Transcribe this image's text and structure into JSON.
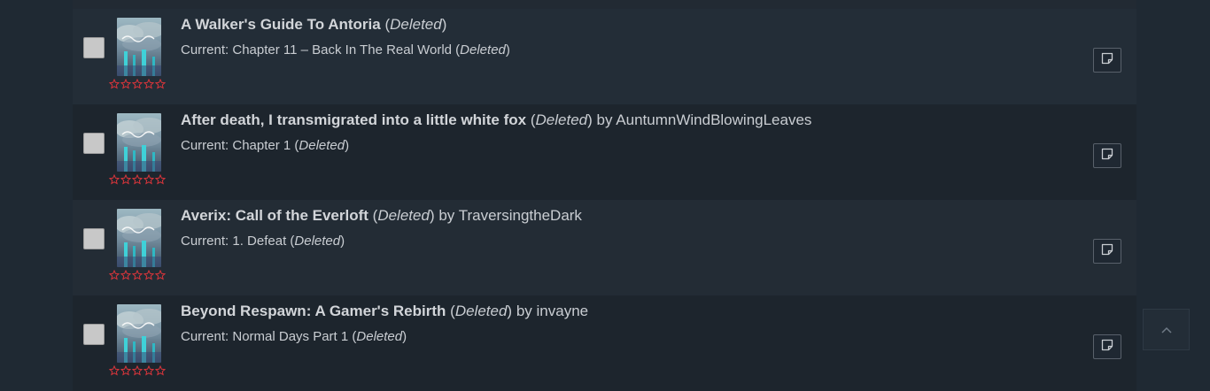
{
  "stories": [
    {
      "title": "A Walker's Guide To Antoria",
      "status": "Deleted",
      "by": "",
      "author": "",
      "current_prefix": "Current: ",
      "chapter": "Chapter 11 – Back In The Real World",
      "chapter_status": "Deleted",
      "rating": 0
    },
    {
      "title": "After death, I transmigrated into a little white fox",
      "status": "Deleted",
      "by": "by",
      "author": "AuntumnWindBlowingLeaves",
      "current_prefix": "Current: ",
      "chapter": "Chapter 1",
      "chapter_status": "Deleted",
      "rating": 0
    },
    {
      "title": "Averix: Call of the Everloft",
      "status": "Deleted",
      "by": "by",
      "author": "TraversingtheDark",
      "current_prefix": "Current: ",
      "chapter": "1. Defeat",
      "chapter_status": "Deleted",
      "rating": 0
    },
    {
      "title": "Beyond Respawn: A Gamer's Rebirth",
      "status": "Deleted",
      "by": "by",
      "author": "invayne",
      "current_prefix": "Current: ",
      "chapter": "Normal Days Part 1",
      "chapter_status": "Deleted",
      "rating": 0
    }
  ],
  "icons": {
    "note": "note-icon",
    "scroll_top": "chevron-up-icon",
    "star": "star-outline-icon"
  },
  "colors": {
    "background": "#1f2933",
    "row": "#232d37",
    "row_alt": "#1d252d",
    "star": "#d9353b",
    "text": "#c9cdd2"
  }
}
